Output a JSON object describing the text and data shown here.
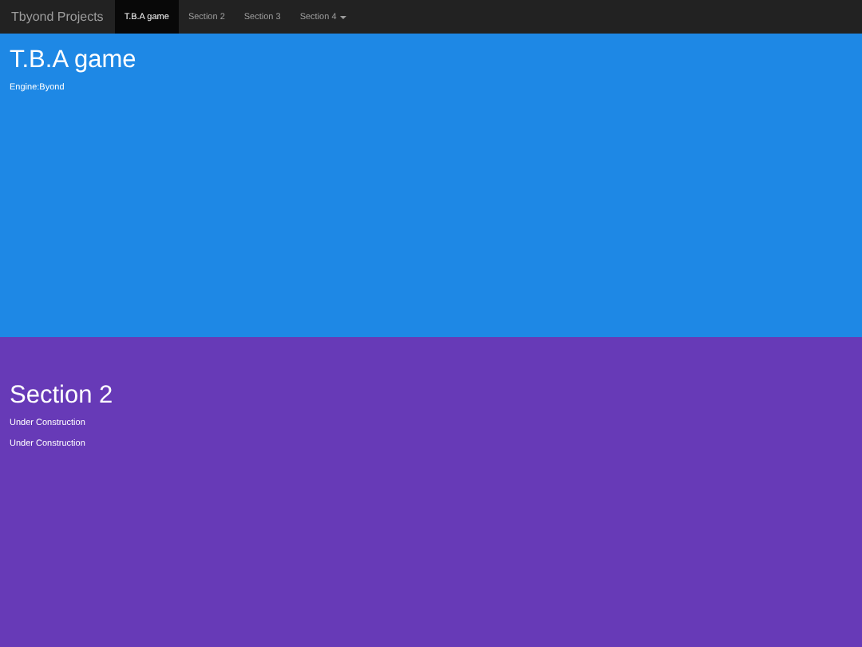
{
  "navbar": {
    "brand": "Tbyond Projects",
    "items": [
      {
        "label": "T.B.A game",
        "selected": true,
        "dropdown": false
      },
      {
        "label": "Section 2",
        "selected": false,
        "dropdown": false
      },
      {
        "label": "Section 3",
        "selected": false,
        "dropdown": false
      },
      {
        "label": "Section 4",
        "selected": false,
        "dropdown": true
      }
    ]
  },
  "sections": [
    {
      "title": "T.B.A game",
      "color": "#1e88e5",
      "lines": [
        "Engine:Byond"
      ]
    },
    {
      "title": "Section 2",
      "color": "#673ab7",
      "lines": [
        "Under Construction",
        "Under Construction"
      ]
    }
  ]
}
